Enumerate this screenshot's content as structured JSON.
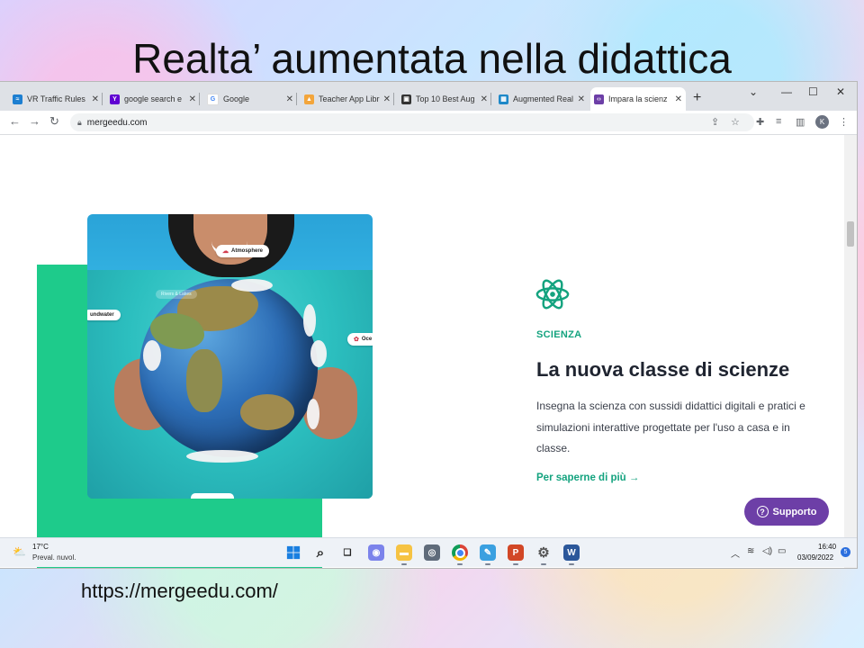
{
  "slide": {
    "title": "Realta’ aumentata nella didattica",
    "url": "https://mergeedu.com/"
  },
  "browser": {
    "tabs": [
      {
        "label": "VR Traffic Rules",
        "icon": "vr-traffic-favicon",
        "active": false
      },
      {
        "label": "google search e",
        "icon": "yahoo-favicon",
        "active": false
      },
      {
        "label": "Google",
        "icon": "google-favicon",
        "active": false
      },
      {
        "label": "Teacher App Libr",
        "icon": "teacher-app-favicon",
        "active": false
      },
      {
        "label": "Top 10 Best Aug",
        "icon": "top10-favicon",
        "active": false
      },
      {
        "label": "Augmented Real",
        "icon": "augmented-favicon",
        "active": false
      },
      {
        "label": "Impara la scienz",
        "icon": "merge-favicon",
        "active": true
      }
    ],
    "new_tab_symbol": "+",
    "address": "mergeedu.com",
    "profile_initial": "K"
  },
  "page": {
    "eyebrow": "SCIENZA",
    "headline": "La nuova classe di scienze",
    "body": "Insegna la scienza con sussidi didattici digitali e pratici e simulazioni interattive progettate per l'uso a casa e in classe.",
    "cta": "Per saperne di più",
    "cta_arrow": "→",
    "support_label": "Supporto",
    "support_icon": "?",
    "hero_labels": {
      "atmosphere": "Atmosphere",
      "rivers": "Rivers & Lakes",
      "groundwater": "undwater",
      "oceans": "Oce"
    },
    "colors": {
      "accent": "#14a37f",
      "green_block": "#1ecb8b",
      "support": "#6d3fa7"
    }
  },
  "taskbar": {
    "weather_temp": "17°C",
    "weather_desc": "Preval. nuvol.",
    "time": "16:40",
    "date": "03/09/2022",
    "notifications": "5"
  }
}
